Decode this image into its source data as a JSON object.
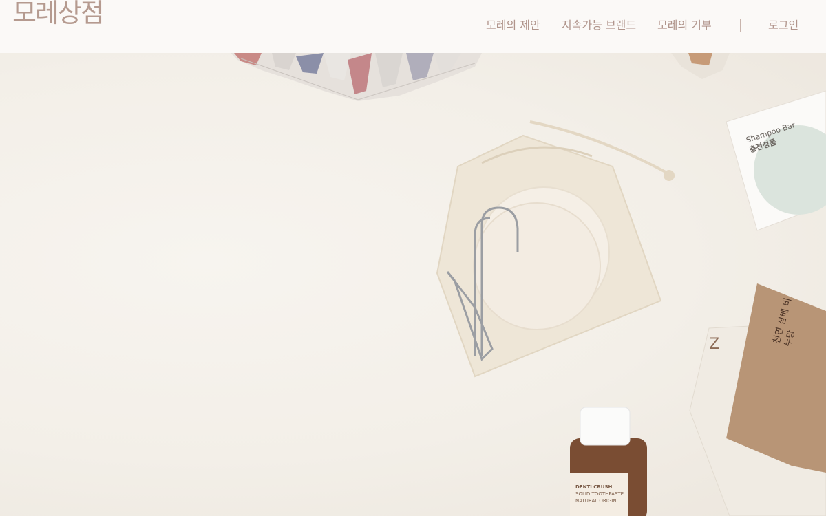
{
  "logo": {
    "text": "모레상점"
  },
  "nav": {
    "items": [
      {
        "label": "모레의 제안"
      },
      {
        "label": "지속가능 브랜드"
      },
      {
        "label": "모레의 기부"
      }
    ],
    "login": "로그인"
  },
  "products": {
    "shampoo_box": {
      "lines": [
        "Shampoo Bar",
        "충전성품"
      ]
    },
    "soap_bag": {
      "lines": [
        "천연",
        "삼베",
        "비누망"
      ]
    },
    "bottle": {
      "lines": [
        "DENTI CRUSH",
        "SOLID TOOTHPASTE",
        "NATURAL ORIGIN"
      ]
    }
  },
  "colors": {
    "header_bg": "#fbf9f7",
    "nav_text": "#b0948b",
    "logo": "#b59a8f",
    "background": "#f3efe8"
  }
}
